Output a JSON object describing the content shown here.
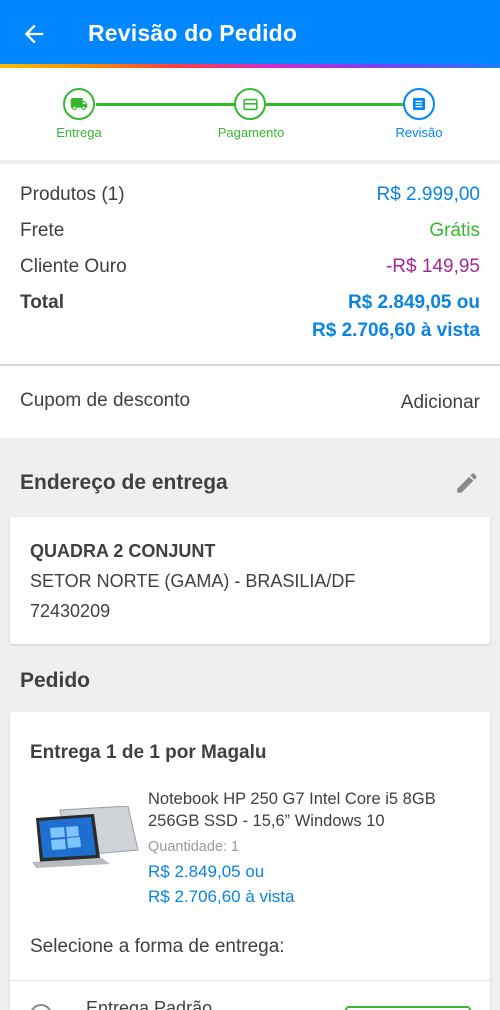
{
  "header": {
    "title": "Revisão do Pedido"
  },
  "stepper": {
    "steps": [
      {
        "label": "Entrega",
        "state": "done",
        "icon": "truck-icon"
      },
      {
        "label": "Pagamento",
        "state": "done",
        "icon": "card-icon"
      },
      {
        "label": "Revisão",
        "state": "current",
        "icon": "list-icon"
      }
    ]
  },
  "summary": {
    "products_label": "Produtos (1)",
    "products_value": "R$ 2.999,00",
    "freight_label": "Frete",
    "freight_value": "Grátis",
    "gold_label": "Cliente Ouro",
    "gold_value": "-R$ 149,95",
    "total_label": "Total",
    "total_value": "R$ 2.849,05 ou",
    "total_cash_value": "R$ 2.706,60 à vista"
  },
  "coupon": {
    "label": "Cupom de desconto",
    "action": "Adicionar"
  },
  "address": {
    "title": "Endereço de entrega",
    "line1": "QUADRA 2 CONJUNT",
    "line2": "SETOR NORTE (GAMA) - BRASILIA/DF",
    "line3": "72430209"
  },
  "order": {
    "title": "Pedido",
    "delivery_title": "Entrega 1 de 1 por Magalu",
    "product_name": "Notebook HP 250 G7 Intel Core i5 8GB 256GB SSD - 15,6” Windows 10",
    "quantity": "Quantidade:  1",
    "price": "R$ 2.849,05 ou",
    "price_cash": "R$ 2.706,60 à vista",
    "select_shipping": "Selecione a forma de entrega:",
    "shipping_option": "Entrega Padrão"
  },
  "colors": {
    "primary": "#0086ff",
    "success": "#35b82f",
    "price": "#0a84e0",
    "discount": "#a2299b"
  }
}
